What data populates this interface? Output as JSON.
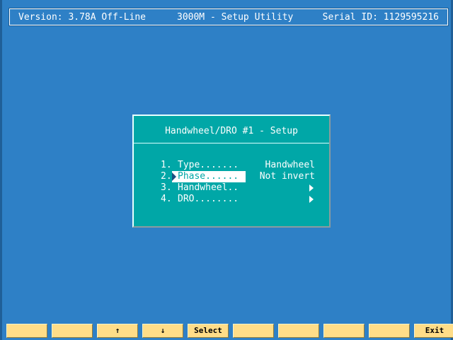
{
  "header": {
    "version": "Version: 3.78A Off-Line",
    "utility": "3000M - Setup Utility",
    "serial": "Serial ID: 1129595216"
  },
  "dialog": {
    "title": "Handwheel/DRO #1 - Setup",
    "items": [
      {
        "num": "1.",
        "label": "Type.......",
        "value": "Handwheel",
        "submenu": false
      },
      {
        "num": "2.",
        "label": "Phase......",
        "value": "Not invert",
        "submenu": false,
        "selected": true
      },
      {
        "num": "3.",
        "label": "Handwheel..",
        "value": "",
        "submenu": true
      },
      {
        "num": "4.",
        "label": "DRO........",
        "value": "",
        "submenu": true
      }
    ]
  },
  "function_keys": [
    {
      "label": ""
    },
    {
      "label": ""
    },
    {
      "label": "↑"
    },
    {
      "label": "↓"
    },
    {
      "label": "Select"
    },
    {
      "label": ""
    },
    {
      "label": ""
    },
    {
      "label": ""
    },
    {
      "label": ""
    },
    {
      "label": "Exit"
    }
  ],
  "colors": {
    "background": "#2e80c6",
    "dialog": "#00a7a7",
    "fkey": "#ffdd88"
  }
}
